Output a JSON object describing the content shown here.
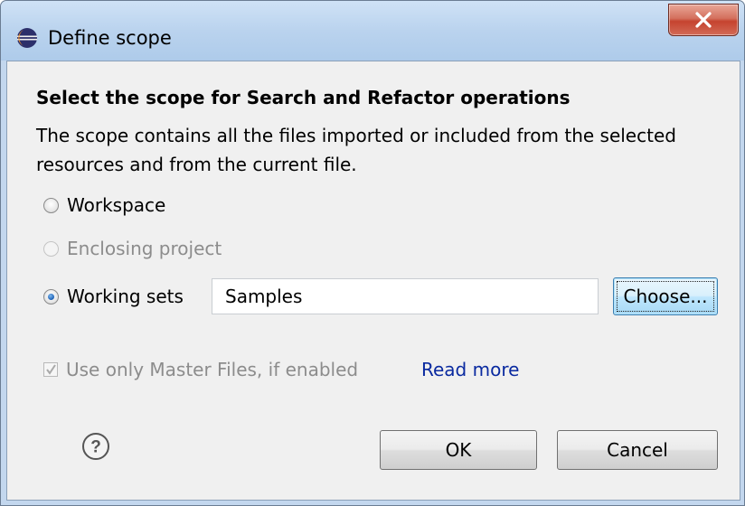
{
  "window": {
    "title": "Define scope"
  },
  "content": {
    "heading": "Select the scope for Search and Refactor operations",
    "description": "The scope contains all the files imported or included from the selected resources and from the current file."
  },
  "scope_options": {
    "workspace": "Workspace",
    "enclosing_project": "Enclosing project",
    "working_sets": "Working sets",
    "selected": "Working sets"
  },
  "working_sets_field": {
    "value": "Samples"
  },
  "buttons": {
    "choose": "Choose...",
    "ok": "OK",
    "cancel": "Cancel"
  },
  "master_files": {
    "label": "Use only Master Files, if enabled",
    "checked": true,
    "enabled": false
  },
  "links": {
    "read_more": "Read more"
  },
  "icons": {
    "app": "eclipse-icon",
    "close": "close-icon",
    "help": "help-icon"
  },
  "colors": {
    "title_bar": "#bad3ee",
    "close_button": "#c5432f",
    "client_background": "#f0f0f0",
    "link": "#0a2aa0",
    "disabled_text": "#8c8c8c"
  }
}
